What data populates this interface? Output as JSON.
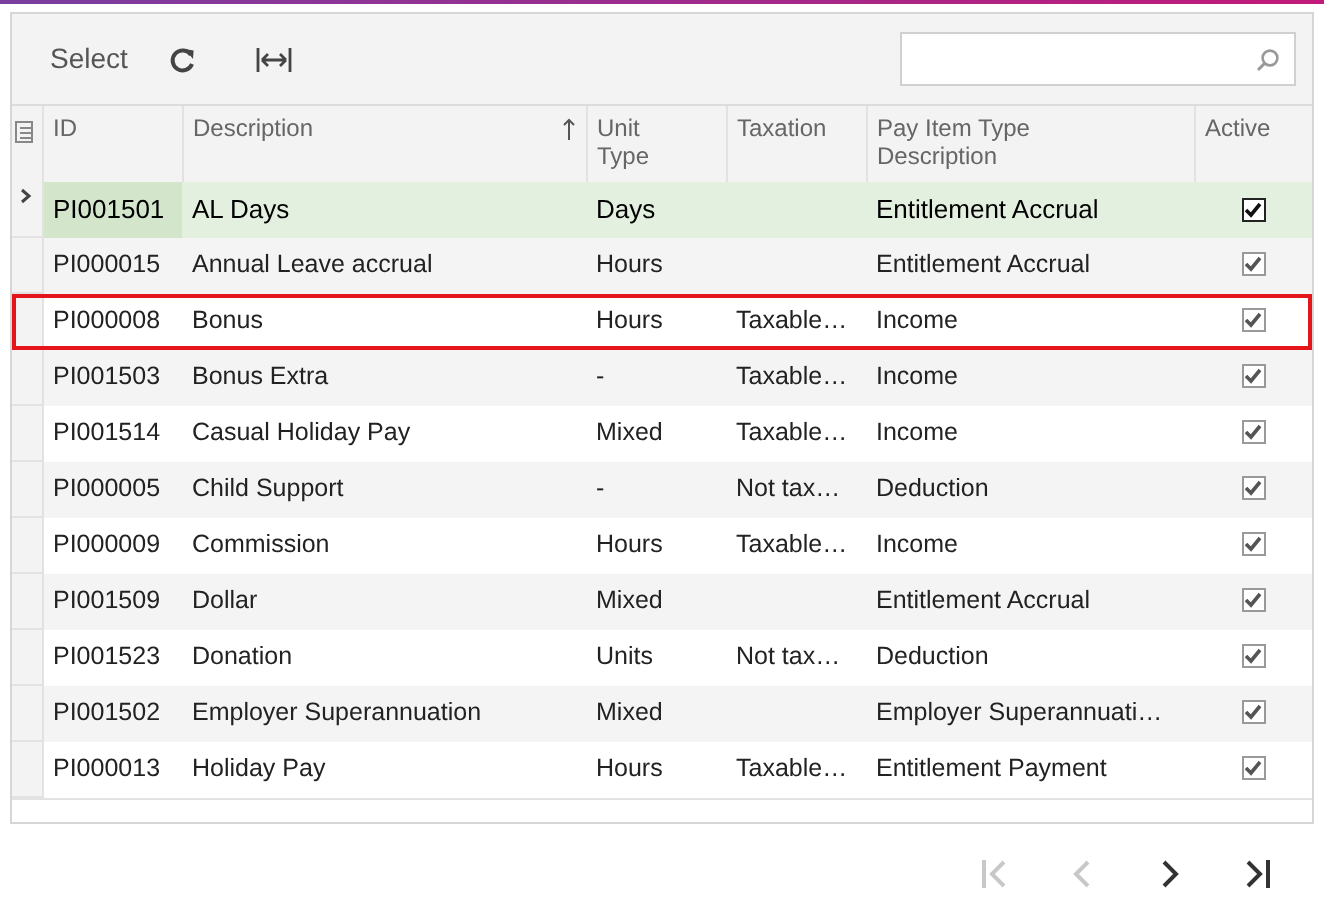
{
  "toolbar": {
    "select_label": "Select"
  },
  "table": {
    "columns": [
      {
        "label": "ID",
        "sorted_ascending": false
      },
      {
        "label": "Description",
        "sorted_ascending": true
      },
      {
        "label": "Unit Type",
        "sorted_ascending": false
      },
      {
        "label": "Taxation",
        "sorted_ascending": false
      },
      {
        "label": "Pay Item Type Description",
        "sorted_ascending": false
      },
      {
        "label": "Active",
        "sorted_ascending": false
      }
    ],
    "rows": [
      {
        "id": "PI001501",
        "description": "AL Days",
        "unit_type": "Days",
        "taxation": "",
        "pay_item_type": "Entitlement Accrual",
        "active": true,
        "selected": true,
        "outlined": false
      },
      {
        "id": "PI000015",
        "description": "Annual Leave accrual",
        "unit_type": "Hours",
        "taxation": "",
        "pay_item_type": "Entitlement Accrual",
        "active": true,
        "selected": false,
        "outlined": false
      },
      {
        "id": "PI000008",
        "description": "Bonus",
        "unit_type": "Hours",
        "taxation": "Taxable…",
        "pay_item_type": "Income",
        "active": true,
        "selected": false,
        "outlined": true
      },
      {
        "id": "PI001503",
        "description": "Bonus Extra",
        "unit_type": "-",
        "taxation": "Taxable…",
        "pay_item_type": "Income",
        "active": true,
        "selected": false,
        "outlined": false
      },
      {
        "id": "PI001514",
        "description": "Casual Holiday Pay",
        "unit_type": "Mixed",
        "taxation": "Taxable…",
        "pay_item_type": "Income",
        "active": true,
        "selected": false,
        "outlined": false
      },
      {
        "id": "PI000005",
        "description": "Child Support",
        "unit_type": "-",
        "taxation": "Not tax…",
        "pay_item_type": "Deduction",
        "active": true,
        "selected": false,
        "outlined": false
      },
      {
        "id": "PI000009",
        "description": "Commission",
        "unit_type": "Hours",
        "taxation": "Taxable…",
        "pay_item_type": "Income",
        "active": true,
        "selected": false,
        "outlined": false
      },
      {
        "id": "PI001509",
        "description": "Dollar",
        "unit_type": "Mixed",
        "taxation": "",
        "pay_item_type": "Entitlement Accrual",
        "active": true,
        "selected": false,
        "outlined": false
      },
      {
        "id": "PI001523",
        "description": "Donation",
        "unit_type": "Units",
        "taxation": "Not tax…",
        "pay_item_type": "Deduction",
        "active": true,
        "selected": false,
        "outlined": false
      },
      {
        "id": "PI001502",
        "description": "Employer Superannuation",
        "unit_type": "Mixed",
        "taxation": "",
        "pay_item_type": "Employer Superannuati…",
        "active": true,
        "selected": false,
        "outlined": false
      },
      {
        "id": "PI000013",
        "description": "Holiday Pay",
        "unit_type": "Hours",
        "taxation": "Taxable…",
        "pay_item_type": "Entitlement Payment",
        "active": true,
        "selected": false,
        "outlined": false
      }
    ]
  },
  "pager": [
    {
      "kind": "first",
      "disabled": true
    },
    {
      "kind": "prev",
      "disabled": true
    },
    {
      "kind": "next",
      "disabled": false
    },
    {
      "kind": "last",
      "disabled": false
    }
  ]
}
